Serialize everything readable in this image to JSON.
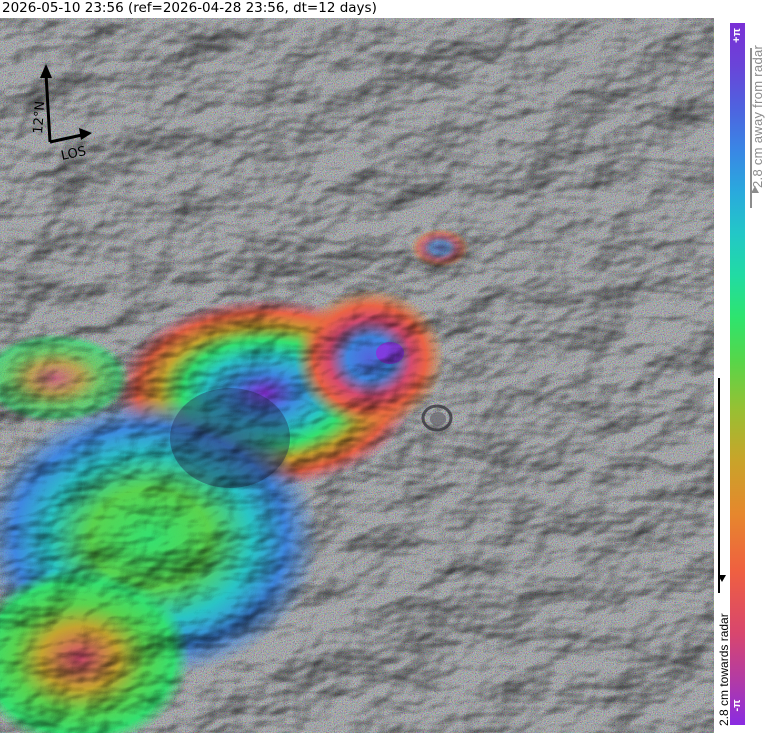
{
  "title": "2026-05-10 23:56 (ref=2026-04-28 23:56, dt=12 days)",
  "compass": {
    "north_label": "12°N",
    "los_label": "LOS"
  },
  "colorbar": {
    "top_label": "+π",
    "bottom_label": "-π",
    "away_label": "2.8 cm away from radar",
    "towards_label": "2.8 cm towards radar",
    "colors": [
      "#8a2be2",
      "#d8466e",
      "#e6872d",
      "#97c033",
      "#2ee46e",
      "#23c7c7",
      "#3a86e5",
      "#7a2fd6"
    ]
  },
  "map": {
    "icon": "interferogram-phase-map",
    "base_color": "#7d7a86"
  }
}
